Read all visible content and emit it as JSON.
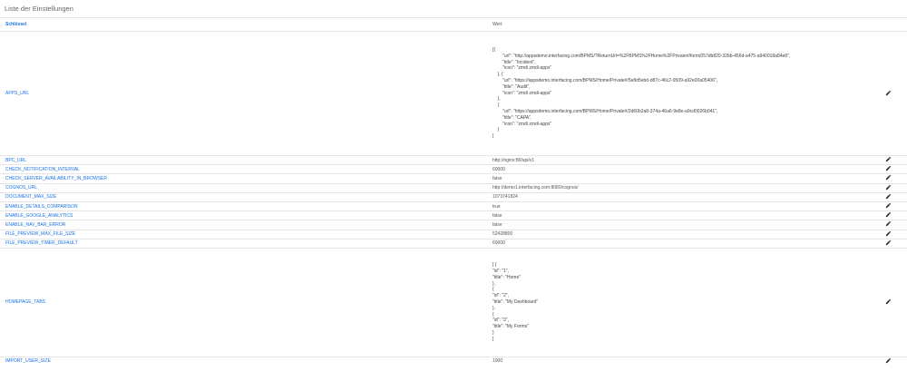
{
  "page": {
    "title": "Liste der Einstellungen"
  },
  "table": {
    "headers": {
      "key": "Schlüssel",
      "value": "Wert"
    },
    "apps_url": {
      "key": "APPS_URL",
      "value": "[{\n        \"url\": \"http://appsdemo.interfacing.com/BPMS/?ReturnUrl=%2FBPMS%2FHome%2FPrivate#/form/057db820-32bb-456d-a475-a940018a84e8\",\n        \"title\": \"Incident\",\n        \"icon\": \"zmdi zmdi-apps\"\n    }, {\n        \"url\": \"https://appsdemo.interfacing.com/BPMS/Home/Private#/5e8d5ebd-d87c-46c2-9509-a92e00a05406\",\n        \"title\": \"Audit\",\n        \"icon\": \"zmdi zmdi-apps\"\n    },\n    {\n        \"url\": \"https://appsdemo.interfacing.com/BPMS/Home/Private#/2d60b2a8-374a-46a6-9e8e-a9cd0026b041\",\n        \"title\": \"CAPA\",\n        \"icon\": \"zmdi zmdi-apps\"\n    }\n]"
    },
    "rows_mid": [
      {
        "key": "BPC_URL",
        "value": "http://nginx:80/api/v1"
      },
      {
        "key": "CHECK_NOTIFICATION_INTERVAL",
        "value": "60000"
      },
      {
        "key": "CHECK_SERVER_AVAILABILITY_IN_BROWSER",
        "value": "false"
      },
      {
        "key": "COGNOS_URL",
        "value": "http://demo1.interfacing.com:8080/cognos/"
      },
      {
        "key": "DOCUMENT_MAX_SIZE",
        "value": "1073741824"
      },
      {
        "key": "ENABLE_DETAILS_COMPARISON",
        "value": "true"
      },
      {
        "key": "ENABLE_GOOGLE_ANALYTICS",
        "value": "false"
      },
      {
        "key": "ENABLE_NAV_BAR_ERROR",
        "value": "false"
      },
      {
        "key": "FILE_PREVIEW_MAX_FILE_SIZE",
        "value": "52428800"
      },
      {
        "key": "FILE_PREVIEW_TIMER_DEFAULT",
        "value": "60000"
      }
    ],
    "homepage_tabs": {
      "key": "HOMEPAGE_TABS",
      "value": "[ {\n\"id\": \"1\",\n\"title\": \"Home\"\n},\n{\n\"id\": \"2\",\n\"title\": \"My Dashboard\"\n},\n{\n\"id\": \"3\",\n\"title\": \"My Forms\"\n}\n]"
    },
    "import_user_size": {
      "key": "IMPORT_USER_SIZE",
      "value": "1000"
    }
  },
  "icons": {
    "edit": "pencil-icon"
  },
  "colors": {
    "key_link": "#1a73e8",
    "border": "#e6e6e6"
  }
}
